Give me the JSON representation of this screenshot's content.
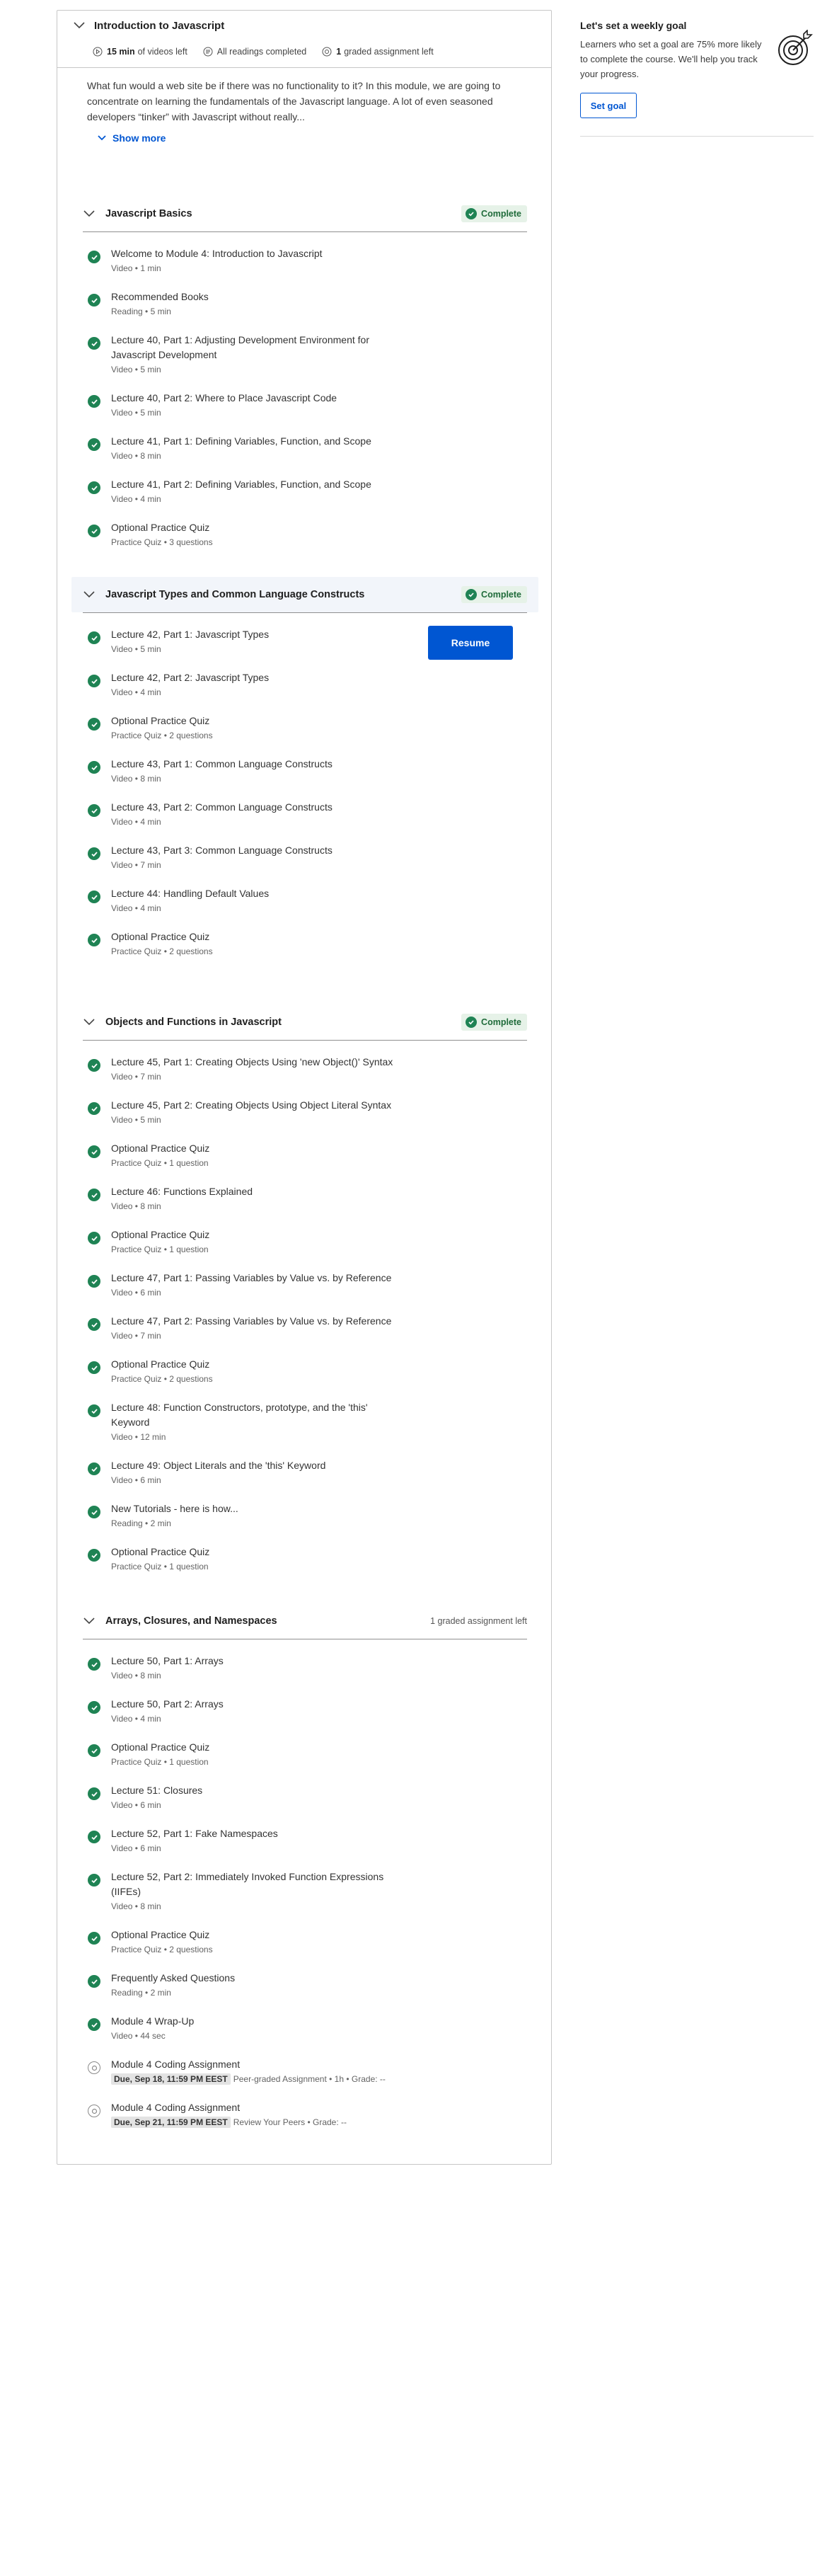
{
  "module": {
    "title": "Introduction to Javascript",
    "meta": {
      "videos_minutes": "15 min",
      "videos_suffix": "of videos left",
      "readings": "All readings completed",
      "graded_count": "1",
      "graded_suffix": "graded assignment left"
    },
    "description": "What fun would a web site be if there was no functionality to it? In this module, we are going to concentrate on learning the fundamentals of the Javascript language. A lot of even seasoned developers “tinker” with Javascript without really...",
    "show_more_label": "Show more"
  },
  "lessons": [
    {
      "title": "Javascript Basics",
      "status": "Complete",
      "items": [
        {
          "name": "Welcome to Module 4: Introduction to Javascript",
          "sub": "Video • 1 min"
        },
        {
          "name": "Recommended Books",
          "sub": "Reading • 5 min"
        },
        {
          "name": "Lecture 40, Part 1: Adjusting Development Environment for Javascript Development",
          "sub": "Video • 5 min"
        },
        {
          "name": "Lecture 40, Part 2: Where to Place Javascript Code",
          "sub": "Video • 5 min"
        },
        {
          "name": "Lecture 41, Part 1: Defining Variables, Function, and Scope",
          "sub": "Video • 8 min"
        },
        {
          "name": "Lecture 41, Part 2: Defining Variables, Function, and Scope",
          "sub": "Video • 4 min"
        },
        {
          "name": "Optional Practice Quiz",
          "sub": "Practice Quiz • 3 questions"
        }
      ]
    },
    {
      "title": "Javascript Types and Common Language Constructs",
      "status": "Complete",
      "resume_label": "Resume",
      "items": [
        {
          "name": "Lecture 42, Part 1: Javascript Types",
          "sub": "Video • 5 min"
        },
        {
          "name": "Lecture 42, Part 2: Javascript Types",
          "sub": "Video • 4 min"
        },
        {
          "name": "Optional Practice Quiz",
          "sub": "Practice Quiz • 2 questions"
        },
        {
          "name": "Lecture 43, Part 1: Common Language Constructs",
          "sub": "Video • 8 min"
        },
        {
          "name": "Lecture 43, Part 2: Common Language Constructs",
          "sub": "Video • 4 min"
        },
        {
          "name": "Lecture 43, Part 3: Common Language Constructs",
          "sub": "Video • 7 min"
        },
        {
          "name": "Lecture 44: Handling Default Values",
          "sub": "Video • 4 min"
        },
        {
          "name": "Optional Practice Quiz",
          "sub": "Practice Quiz • 2 questions"
        }
      ]
    },
    {
      "title": "Objects and Functions in Javascript",
      "status": "Complete",
      "items": [
        {
          "name": "Lecture 45, Part 1: Creating Objects Using 'new Object()' Syntax",
          "sub": "Video • 7 min"
        },
        {
          "name": "Lecture 45, Part 2: Creating Objects Using Object Literal Syntax",
          "sub": "Video • 5 min"
        },
        {
          "name": "Optional Practice Quiz",
          "sub": "Practice Quiz • 1 question"
        },
        {
          "name": "Lecture 46: Functions Explained",
          "sub": "Video • 8 min"
        },
        {
          "name": "Optional Practice Quiz",
          "sub": "Practice Quiz • 1 question"
        },
        {
          "name": "Lecture 47, Part 1: Passing Variables by Value vs. by Reference",
          "sub": "Video • 6 min"
        },
        {
          "name": "Lecture 47, Part 2: Passing Variables by Value vs. by Reference",
          "sub": "Video • 7 min"
        },
        {
          "name": "Optional Practice Quiz",
          "sub": "Practice Quiz • 2 questions"
        },
        {
          "name": "Lecture 48: Function Constructors, prototype, and the 'this' Keyword",
          "sub": "Video • 12 min"
        },
        {
          "name": "Lecture 49: Object Literals and the 'this' Keyword",
          "sub": "Video • 6 min"
        },
        {
          "name": "New Tutorials - here is how...",
          "sub": "Reading • 2 min"
        },
        {
          "name": "Optional Practice Quiz",
          "sub": "Practice Quiz • 1 question"
        }
      ]
    },
    {
      "title": "Arrays, Closures, and Namespaces",
      "graded_left": "1 graded assignment left",
      "items": [
        {
          "name": "Lecture 50, Part 1: Arrays",
          "sub": "Video • 8 min"
        },
        {
          "name": "Lecture 50, Part 2: Arrays",
          "sub": "Video • 4 min"
        },
        {
          "name": "Optional Practice Quiz",
          "sub": "Practice Quiz • 1 question"
        },
        {
          "name": "Lecture 51: Closures",
          "sub": "Video • 6 min"
        },
        {
          "name": "Lecture 52, Part 1: Fake Namespaces",
          "sub": "Video • 6 min"
        },
        {
          "name": "Lecture 52, Part 2: Immediately Invoked Function Expressions (IIFEs)",
          "sub": "Video • 8 min"
        },
        {
          "name": "Optional Practice Quiz",
          "sub": "Practice Quiz • 2 questions"
        },
        {
          "name": "Frequently Asked Questions",
          "sub": "Reading • 2 min"
        },
        {
          "name": "Module 4 Wrap-Up",
          "sub": "Video • 44 sec"
        },
        {
          "name": "Module 4 Coding Assignment",
          "due": "Due, Sep 18, 11:59 PM EEST",
          "sub": "Peer-graded Assignment • 1h • Grade: --"
        },
        {
          "name": "Module 4 Coding Assignment",
          "due": "Due, Sep 21, 11:59 PM EEST",
          "sub": "Review Your Peers • Grade: --"
        }
      ]
    }
  ],
  "goal": {
    "title": "Let's set a weekly goal",
    "text": "Learners who set a goal are 75% more likely to complete the course. We'll help you track your progress.",
    "button_label": "Set goal"
  },
  "colors": {
    "accent": "#0056d2",
    "complete": "#1f8354"
  }
}
